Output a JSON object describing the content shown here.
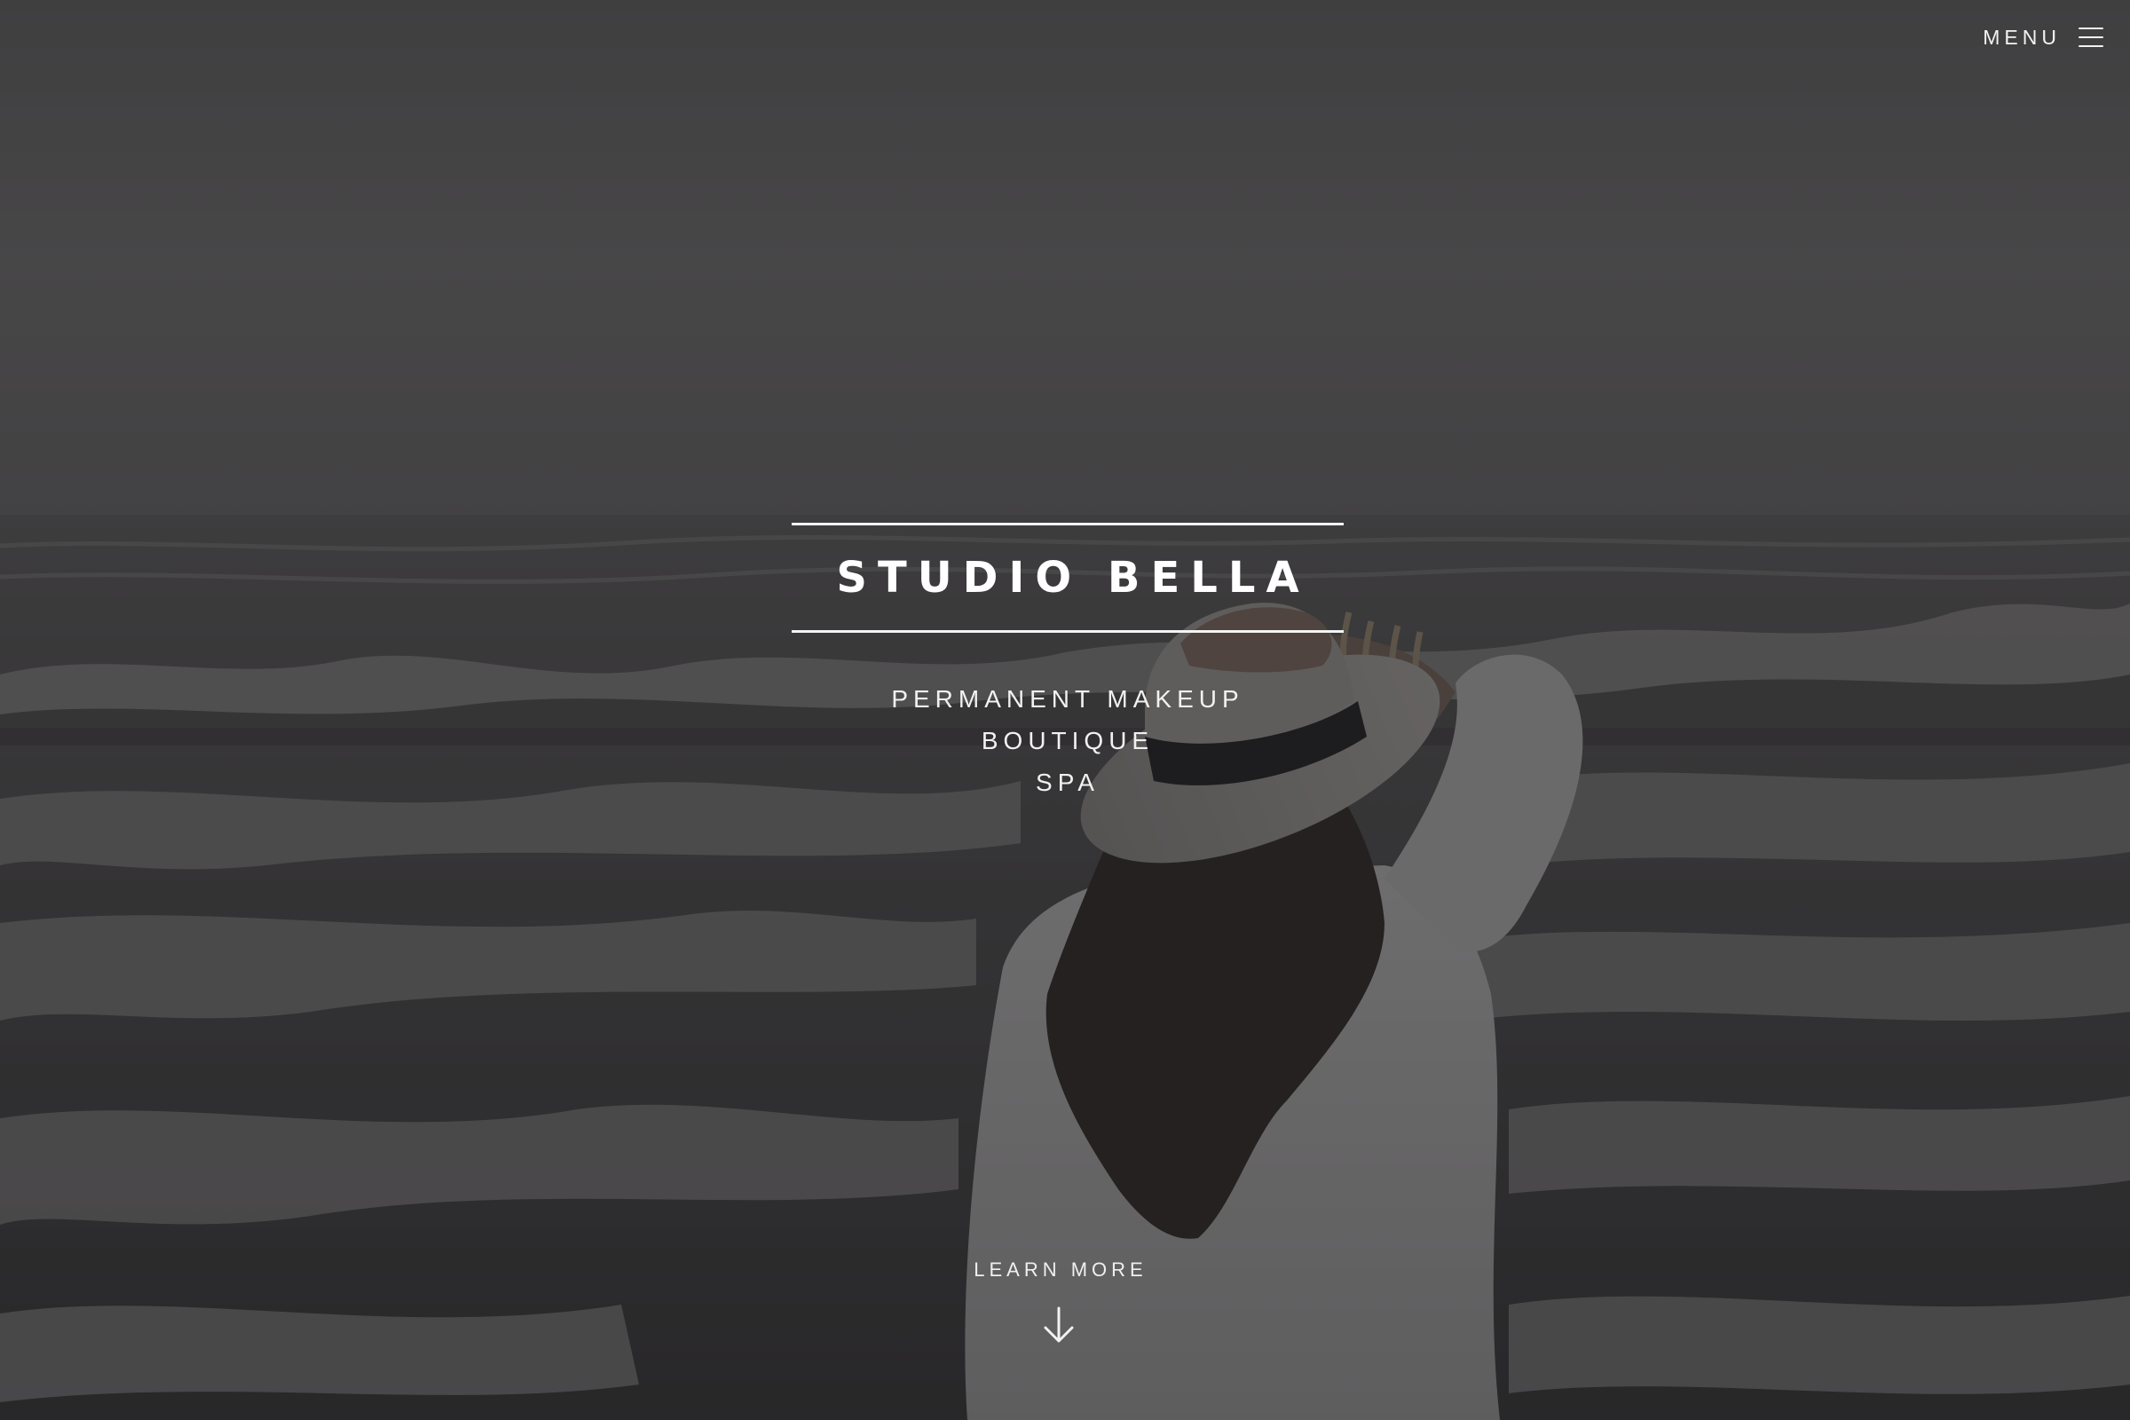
{
  "header": {
    "menu_label": "MENU",
    "menu_icon": "hamburger-icon"
  },
  "hero": {
    "title": "STUDIO BELLA",
    "services": [
      "PERMANENT MAKEUP",
      "BOUTIQUE",
      "SPA"
    ],
    "cta_label": "LEARN MORE",
    "cta_icon": "arrow-down-icon",
    "background_image": "woman in white shirt and straw hat facing the ocean waves under a grey sky",
    "overlay_color": "#2a2a2c"
  }
}
